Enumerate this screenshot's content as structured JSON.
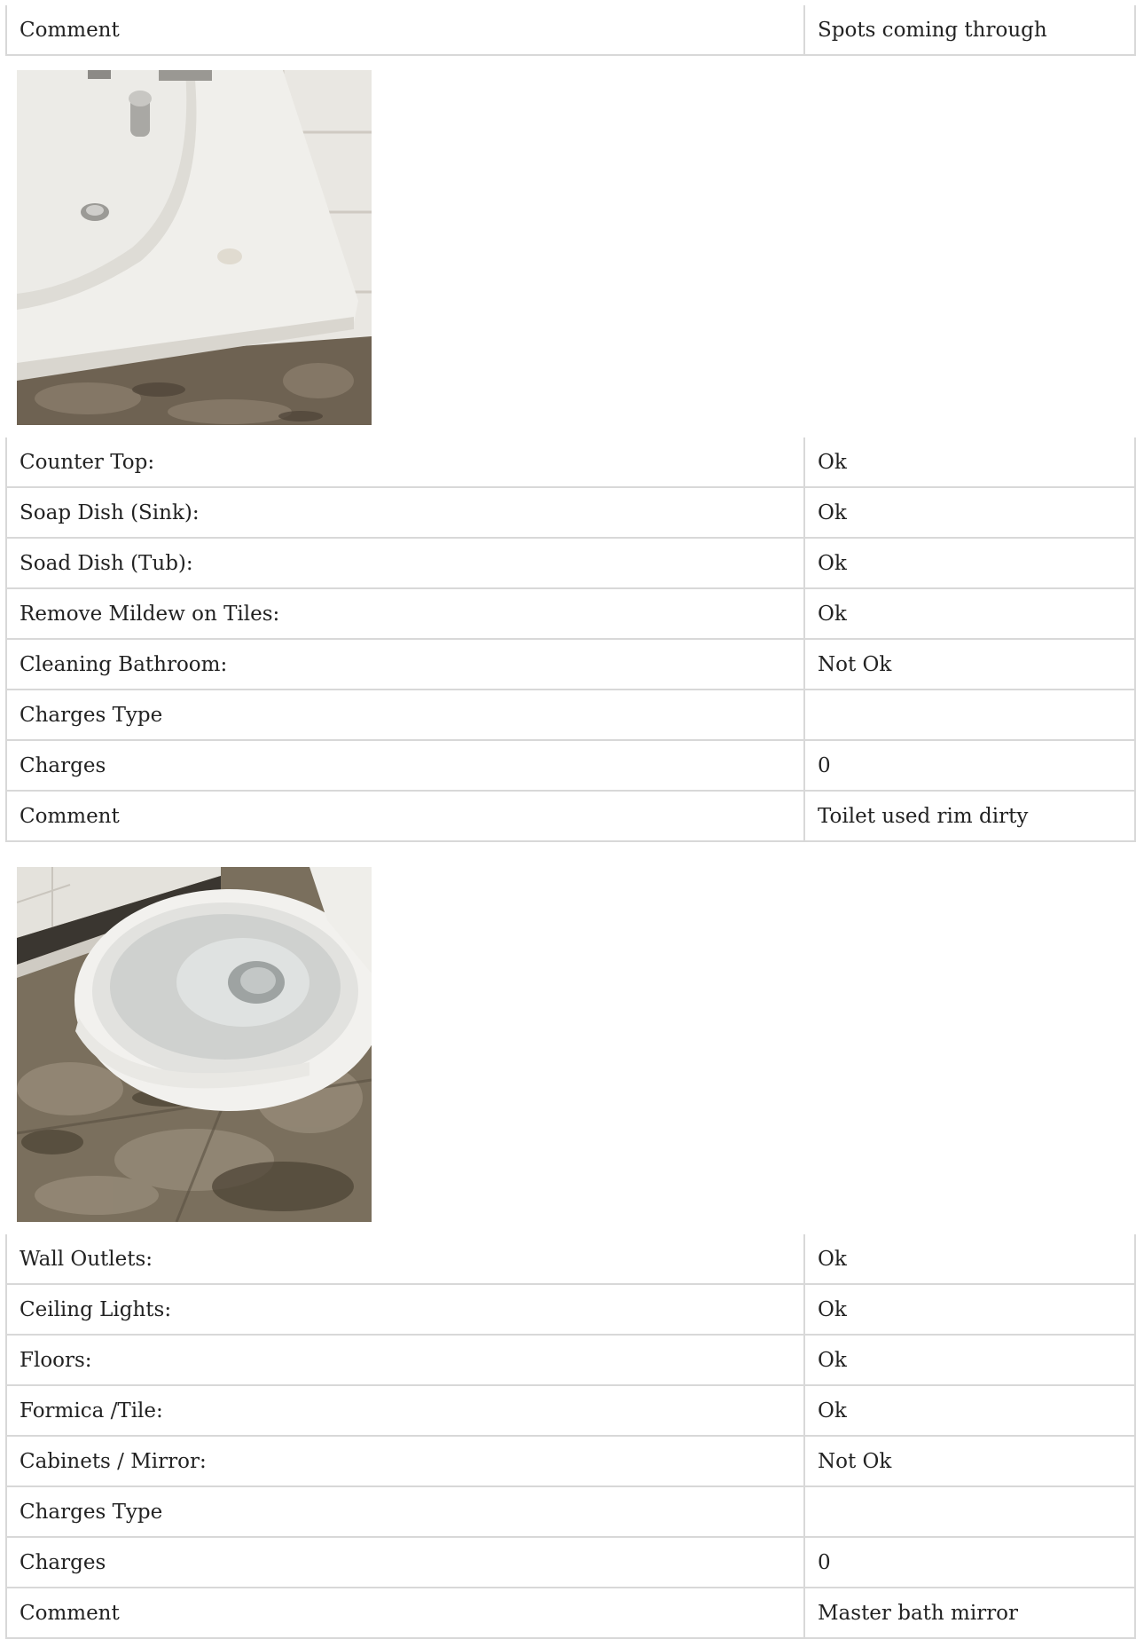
{
  "sections": [
    {
      "rows": [
        {
          "label": "Comment",
          "value": "Spots coming through"
        }
      ],
      "photo": {
        "subject": "sink-photo"
      }
    },
    {
      "rows": [
        {
          "label": "Counter Top:",
          "value": "Ok"
        },
        {
          "label": "Soap Dish (Sink):",
          "value": "Ok"
        },
        {
          "label": "Soad Dish (Tub):",
          "value": "Ok"
        },
        {
          "label": "Remove Mildew on Tiles:",
          "value": "Ok"
        },
        {
          "label": "Cleaning Bathroom:",
          "value": "Not Ok"
        },
        {
          "label": "Charges Type",
          "value": ""
        },
        {
          "label": "Charges",
          "value": "0"
        },
        {
          "label": "Comment",
          "value": "Toilet used rim dirty"
        }
      ],
      "photo": {
        "subject": "toilet-photo"
      }
    },
    {
      "rows": [
        {
          "label": "Wall Outlets:",
          "value": "Ok"
        },
        {
          "label": "Ceiling Lights:",
          "value": "Ok"
        },
        {
          "label": "Floors:",
          "value": "Ok"
        },
        {
          "label": "Formica /Tile:",
          "value": "Ok"
        },
        {
          "label": "Cabinets / Mirror:",
          "value": "Not Ok"
        },
        {
          "label": "Charges Type",
          "value": ""
        },
        {
          "label": "Charges",
          "value": "0"
        },
        {
          "label": "Comment",
          "value": "Master bath mirror"
        }
      ]
    }
  ]
}
